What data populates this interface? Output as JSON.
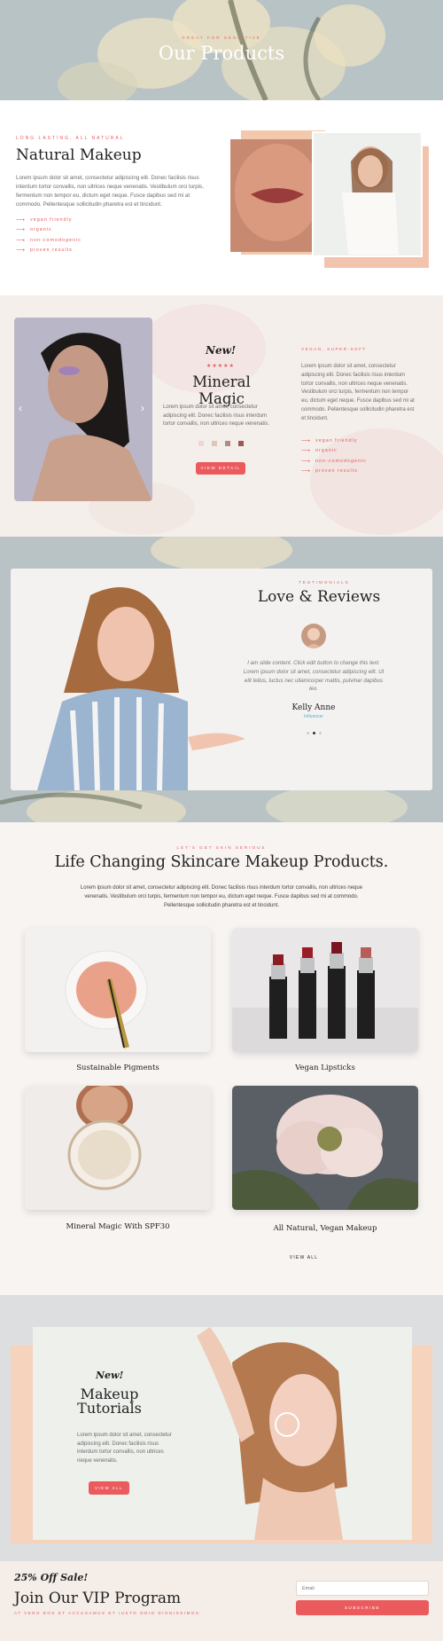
{
  "hero": {
    "kicker": "GREAT FOR SENSITIVE",
    "title": "Our Products"
  },
  "natural": {
    "kicker": "LONG LASTING, ALL NATURAL",
    "title": "Natural Makeup",
    "body": "Lorem ipsum dolor sit amet, consectetur adipiscing elit. Donec facilisis risus interdum tortor convallis, non ultrices neque venenatis. Vestibulum orci turpis, fermentum non tempor eu, dictum eget neque. Fusce dapibus sed mi at commodo. Pellentesque sollicitudin pharetra est et tincidunt.",
    "features": [
      "vegan friendly",
      "organic",
      "non-comodogenic",
      "proven results"
    ]
  },
  "mineral": {
    "badge": "New!",
    "stars": "★★★★★",
    "title": "Mineral Magic",
    "body": "Lorem ipsum dolor sit amet, consectetur adipiscing elit. Donec facilisis risus interdum tortor convallis, non ultrices neque venenatis.",
    "swatches": [
      "#f1d6cf",
      "#dcc7bd",
      "#b58b7f",
      "#9b5a56"
    ],
    "button": "VIEW DETAIL",
    "right_kicker": "VEGAN, SUPER-SOFT",
    "right_body": "Lorem ipsum dolor sit amet, consectetur adipiscing elit. Donec facilisis risus interdum tortor convallis, non ultrices neque venenatis. Vestibulum orci turpis, fermentum non tempor eu, dictum eget neque. Fusce dapibus sed mi at commodo. Pellentesque sollicitudin pharetra est et tincidunt.",
    "features": [
      "vegan friendly",
      "organic",
      "non-comodogenic",
      "proven results"
    ],
    "arrow_left": "‹",
    "arrow_right": "›"
  },
  "reviews": {
    "kicker": "TESTIMONIALS",
    "title": "Love & Reviews",
    "quote": "I am slide content. Click edit button to change this text. Lorem ipsum dolor sit amet, consectetur adipiscing elit. Ut elit tellus, luctus nec ullamcorper mattis, pulvinar dapibus leo.",
    "name": "Kelly Anne",
    "role": "Influencer"
  },
  "products": {
    "kicker": "LET'S GET SKIN SERIOUS",
    "title": "Life Changing Skincare Makeup Products.",
    "intro": "Lorem ipsum dolor sit amet, consectetur adipiscing elit. Donec facilisis risus interdum tortor convallis, non ultrices neque venenatis. Vestibulum orci turpis, fermentum non tempor eu, dictum eget neque. Fusce dapibus sed mi at commodo. Pellentesque sollicitudin pharetra est et tincidunt.",
    "items": [
      {
        "name": "Sustainable Pigments"
      },
      {
        "name": "Vegan Lipsticks"
      },
      {
        "name": "Mineral Magic With SPF30"
      },
      {
        "name": "All Natural, Vegan Makeup"
      }
    ],
    "view_all": "VIEW ALL"
  },
  "tutorials": {
    "badge": "New!",
    "title": "Makeup Tutorials",
    "body": "Lorem ipsum dolor sit amet, consectetur adipiscing elit. Donec facilisis risus interdum tortor convallis, non ultrices neque venenatis.",
    "button": "VIEW ALL"
  },
  "vip": {
    "offer": "25% Off Sale!",
    "title": "Join Our VIP Program",
    "sub": "AT VERO EOS ET ACCUSAMUS ET IUSTO ODIO DIGNISSIMOS.",
    "email_placeholder": "Email",
    "button": "SUBSCRIBE"
  },
  "colors": {
    "accent": "#eb5b5e",
    "peach": "#f5d3bc",
    "slate": "#b8c3c6"
  }
}
